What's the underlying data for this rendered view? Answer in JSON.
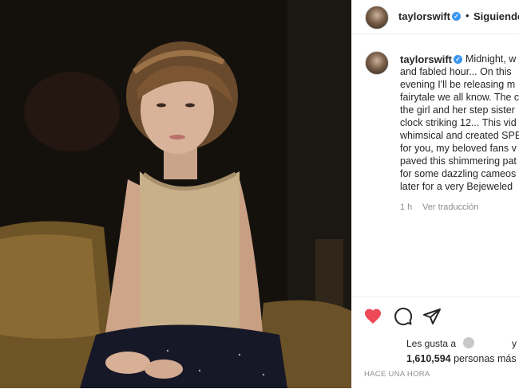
{
  "post": {
    "username": "taylorswift",
    "follow_label": "Siguiendo",
    "dot_separator": "•",
    "verified_badge": "✓",
    "caption_lines": [
      "Midnight, w",
      "and fabled hour... On this",
      "evening I'll be releasing m",
      "fairytale we all know. The c",
      "the girl and her step sister",
      "clock striking 12... This vid",
      "whimsical and created SPE",
      "for you, my beloved fans v",
      "paved this shimmering pat",
      "for some dazzling cameos",
      "later for a very Bejeweled"
    ],
    "time_ago": "1 h",
    "translate_label": "Ver traducción",
    "likes_prefix": "Les gusta a",
    "likes_y": "y",
    "likes_count": "1,610,594",
    "likes_suffix": "personas más",
    "timestamp": "HACE UNA HORA"
  },
  "icons": {
    "like": "heart-icon",
    "comment": "comment-icon",
    "share": "paper-plane-icon"
  },
  "colors": {
    "like": "#ed4956",
    "verified": "#3897f0",
    "text": "#262626",
    "muted": "#8e8e8e"
  }
}
